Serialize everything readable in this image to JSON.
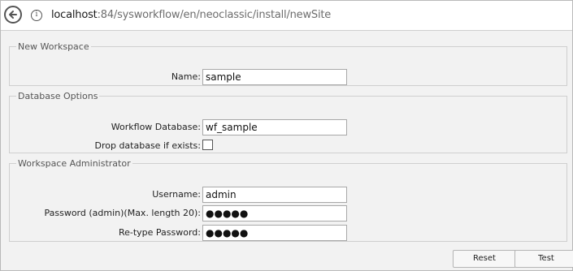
{
  "browser": {
    "url_host": "localhost",
    "url_rest": ":84/sysworkflow/en/neoclassic/install/newSite",
    "icons": {
      "back": "back-arrow-icon",
      "info": "info-icon"
    }
  },
  "sections": {
    "workspace": {
      "legend": "New Workspace",
      "name_label": "Name:",
      "name_value": "sample"
    },
    "database": {
      "legend": "Database Options",
      "db_label": "Workflow Database:",
      "db_value": "wf_sample",
      "drop_label": "Drop database if exists:",
      "drop_checked": false
    },
    "admin": {
      "legend": "Workspace Administrator",
      "username_label": "Username:",
      "username_value": "admin",
      "password_label": "Password (admin)(Max. length 20):",
      "password_value": "●●●●●",
      "retype_label": "Re-type Password:",
      "retype_value": "●●●●●"
    }
  },
  "buttons": {
    "reset": "Reset",
    "test": "Test"
  }
}
